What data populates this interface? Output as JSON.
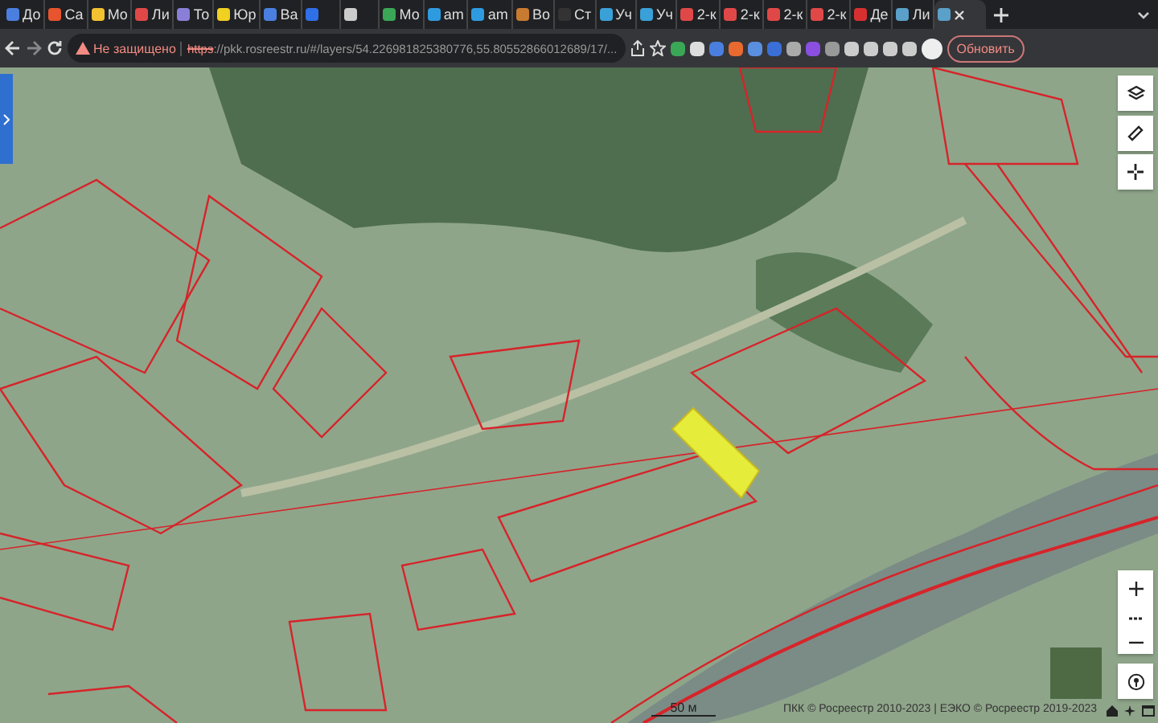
{
  "tabs": [
    {
      "label": "До",
      "color": "#4a7fe0",
      "selected": false
    },
    {
      "label": "Са",
      "color": "#e8542d",
      "selected": false
    },
    {
      "label": "Мо",
      "color": "#f2c230",
      "selected": false
    },
    {
      "label": "Ли",
      "color": "#e04848",
      "selected": false
    },
    {
      "label": "То",
      "color": "#8a7fd8",
      "selected": false
    },
    {
      "label": "Юр",
      "color": "#f0d020",
      "selected": false
    },
    {
      "label": "Ва",
      "color": "#4a7fe0",
      "selected": false
    },
    {
      "color": "#2f6fe8",
      "selected": false
    },
    {
      "color": "#cccccc",
      "selected": false
    },
    {
      "label": "Мо",
      "color": "#3aa757",
      "selected": false
    },
    {
      "label": "am",
      "color": "#2e9be0",
      "selected": false
    },
    {
      "label": "am",
      "color": "#2e9be0",
      "selected": false
    },
    {
      "label": "Во",
      "color": "#c87a30",
      "selected": false
    },
    {
      "label": "Ст",
      "color": "#333333",
      "selected": false
    },
    {
      "label": "Уч",
      "color": "#3aa0d8",
      "selected": false
    },
    {
      "label": "Уч",
      "color": "#3aa0d8",
      "selected": false
    },
    {
      "label": "2-к",
      "color": "#e04848",
      "selected": false
    },
    {
      "label": "2-к",
      "color": "#e04848",
      "selected": false
    },
    {
      "label": "2-к",
      "color": "#e04848",
      "selected": false
    },
    {
      "label": "2-к",
      "color": "#e04848",
      "selected": false
    },
    {
      "label": "Де",
      "color": "#d83030",
      "selected": false
    },
    {
      "label": "Ли",
      "color": "#5aa0c8",
      "selected": false
    },
    {
      "color": "#5aa0c8",
      "selected": true
    }
  ],
  "toolbar": {
    "security": "Не защищено",
    "url_scheme": "https",
    "url_rest": "://pkk.rosreestr.ru/#/layers/54.226981825380776,55.80552866012689/17/...",
    "update_button": "Обновить"
  },
  "map": {
    "scale": "50 м",
    "attribution": "ПКК © Росреестр 2010-2023 | ЕЭКО © Росреестр 2019-2023"
  }
}
